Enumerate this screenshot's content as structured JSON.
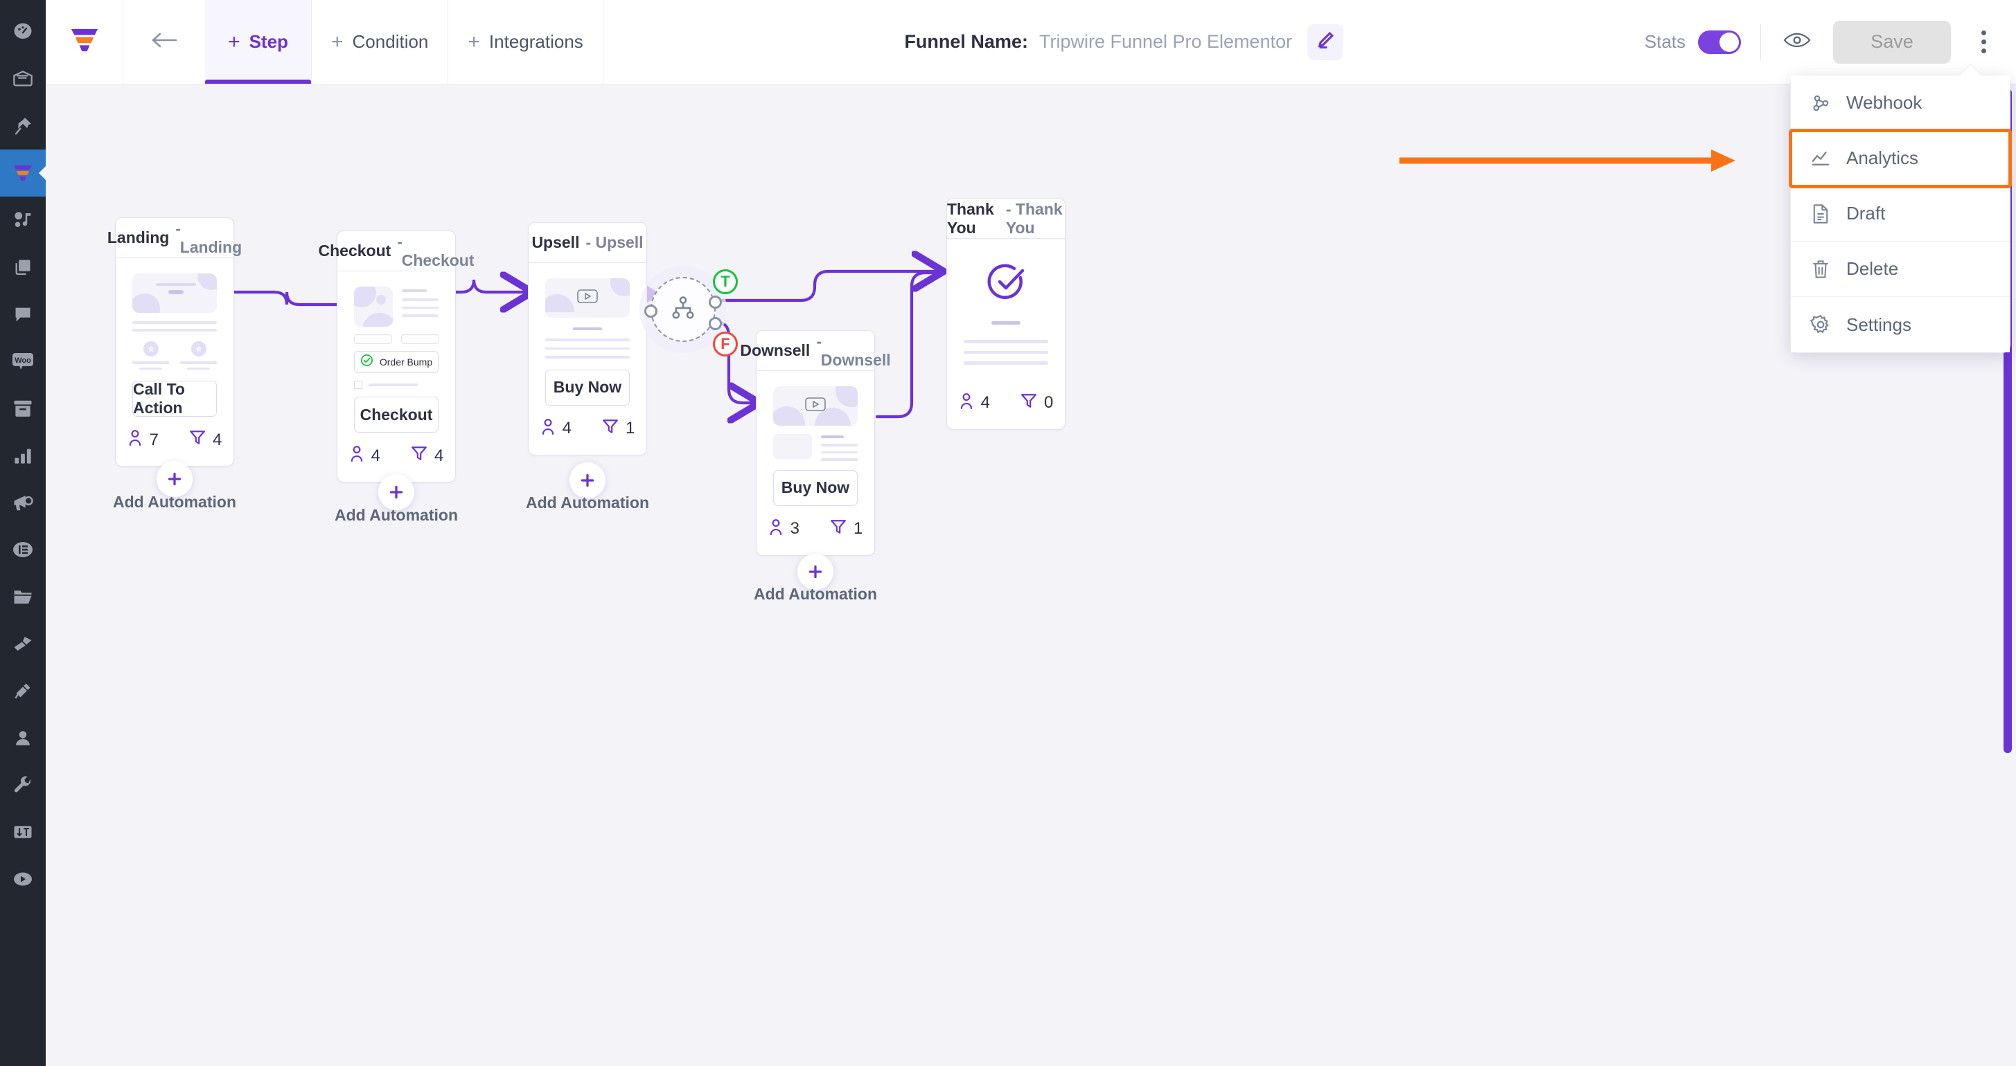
{
  "app": {
    "brand_icon": "funnel-logo-icon",
    "accent_purple": "#6b32d6",
    "accent_orange": "#f97316",
    "canvas_bg": "#f4f3f8",
    "rail_bg": "#23272f",
    "rail_active_bg": "#2f79c4"
  },
  "rail": {
    "items": [
      {
        "icon": "dashboard-gauge-icon",
        "active": false
      },
      {
        "icon": "email-envelope-icon",
        "active": false
      },
      {
        "icon": "pin-icon",
        "active": false
      },
      {
        "icon": "funnel-icon",
        "active": true
      },
      {
        "icon": "media-icon",
        "active": false
      },
      {
        "icon": "copy-pages-icon",
        "active": false
      },
      {
        "icon": "chat-bubble-icon",
        "active": false
      },
      {
        "icon": "woo-icon",
        "active": false
      },
      {
        "icon": "archive-box-icon",
        "active": false
      },
      {
        "icon": "bar-chart-icon",
        "active": false
      },
      {
        "icon": "megaphone-icon",
        "active": false
      },
      {
        "icon": "elementor-icon",
        "active": false
      },
      {
        "icon": "folder-icon",
        "active": false
      },
      {
        "icon": "paint-brush-icon",
        "active": false
      },
      {
        "icon": "plug-icon",
        "active": false
      },
      {
        "icon": "user-icon",
        "active": false
      },
      {
        "icon": "wrench-icon",
        "active": false
      },
      {
        "icon": "ab-test-icon",
        "active": false
      },
      {
        "icon": "play-video-icon",
        "active": false
      }
    ]
  },
  "topbar": {
    "back_icon": "back-arrow-icon",
    "tabs": [
      {
        "label": "Step",
        "active": true
      },
      {
        "label": "Condition",
        "active": false
      },
      {
        "label": "Integrations",
        "active": false
      }
    ],
    "funnel_name_label": "Funnel Name:",
    "funnel_name_value": "Tripwire Funnel Pro Elementor",
    "edit_icon": "pencil-edit-icon",
    "stats_label": "Stats",
    "stats_enabled": true,
    "preview_icon": "eye-preview-icon",
    "save_label": "Save",
    "kebab_icon": "more-vertical-icon"
  },
  "menu": {
    "items": [
      {
        "label": "Webhook",
        "icon": "webhook-icon",
        "highlighted": false
      },
      {
        "label": "Analytics",
        "icon": "analytics-icon",
        "highlighted": true
      },
      {
        "label": "Draft",
        "icon": "document-icon",
        "highlighted": false
      },
      {
        "label": "Delete",
        "icon": "trash-icon",
        "highlighted": false
      },
      {
        "label": "Settings",
        "icon": "gear-icon",
        "highlighted": false
      }
    ]
  },
  "canvas": {
    "add_automation_label": "Add Automation",
    "add_step_icon": "plus-circle-icon",
    "contact_icon": "contact-person-icon",
    "conversion_icon": "funnel-filter-icon",
    "condition_node": {
      "icon": "sitemap-branch-icon",
      "true_label": "T",
      "false_label": "F"
    },
    "nodes": [
      {
        "title": "Landing",
        "type": "Landing",
        "cta_label": "Call To Action",
        "contacts": "7",
        "conversions": "4",
        "has_add_automation": true
      },
      {
        "title": "Checkout",
        "type": "Checkout",
        "order_bump_label": "Order Bump",
        "cta_label": "Checkout",
        "contacts": "4",
        "conversions": "4",
        "has_add_automation": true
      },
      {
        "title": "Upsell",
        "type": "Upsell",
        "cta_label": "Buy Now",
        "contacts": "4",
        "conversions": "1",
        "has_add_automation": true
      },
      {
        "title": "Downsell",
        "type": "Downsell",
        "cta_label": "Buy Now",
        "contacts": "3",
        "conversions": "1",
        "has_add_automation": true
      },
      {
        "title": "Thank You",
        "type": "Thank You",
        "contacts": "4",
        "conversions": "0",
        "has_add_automation": false
      }
    ]
  },
  "annotation": {
    "arrow_icon": "orange-pointer-arrow",
    "points_to": "Analytics"
  }
}
